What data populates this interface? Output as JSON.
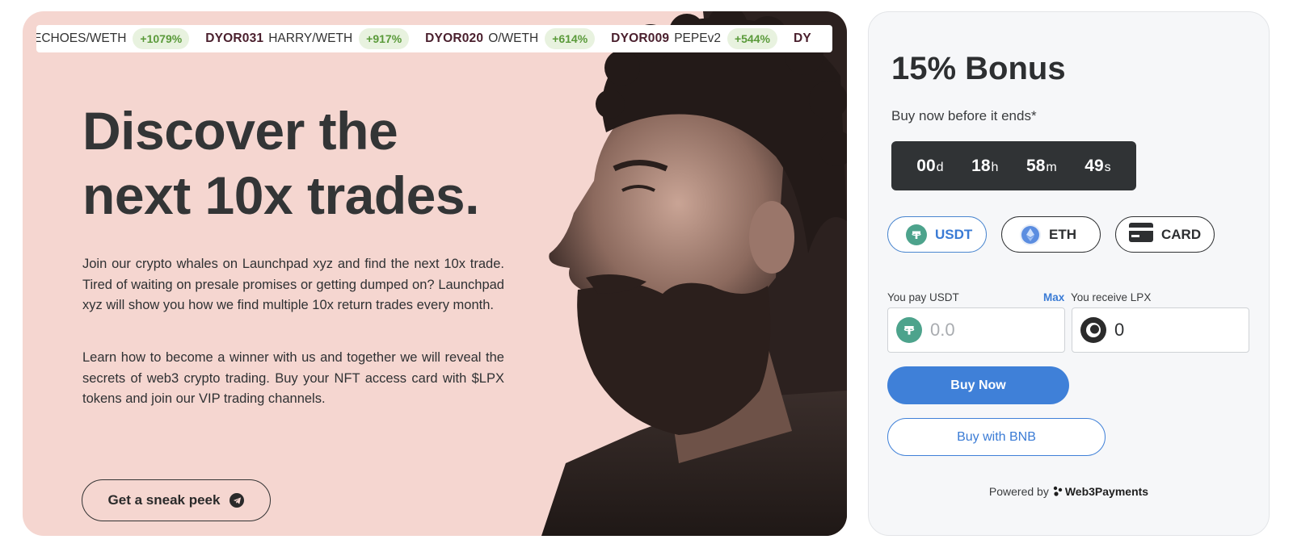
{
  "ticker": [
    {
      "code": "",
      "pair": "ECHOES/WETH",
      "pct": "+1079%"
    },
    {
      "code": "DYOR031",
      "pair": "HARRY/WETH",
      "pct": "+917%"
    },
    {
      "code": "DYOR020",
      "pair": "O/WETH",
      "pct": "+614%"
    },
    {
      "code": "DYOR009",
      "pair": "PEPEv2",
      "pct": "+544%"
    },
    {
      "code": "DY",
      "pair": "",
      "pct": ""
    }
  ],
  "hero": {
    "title_line1": "Discover the",
    "title_line2": "next 10x trades.",
    "paragraph1": "Join our crypto whales on Launchpad xyz and find the next 10x trade. Tired of waiting on presale promises or getting dumped on? Launchpad xyz will show you how we find multiple 10x return trades every month.",
    "paragraph2": "Learn how to become a winner with us and together we will reveal the secrets of web3 crypto trading. Buy your NFT access card with $LPX tokens and join our VIP trading channels.",
    "cta_label": "Get a sneak peek"
  },
  "widget": {
    "bonus_title": "15% Bonus",
    "bonus_sub": "Buy now before it ends*",
    "countdown": {
      "days": "00",
      "days_lbl": "d",
      "hours": "18",
      "hours_lbl": "h",
      "minutes": "58",
      "minutes_lbl": "m",
      "seconds": "49",
      "seconds_lbl": "s"
    },
    "tabs": {
      "usdt": "USDT",
      "eth": "ETH",
      "card": "CARD"
    },
    "pay_label": "You pay USDT",
    "max_label": "Max",
    "receive_label": "You receive LPX",
    "pay_placeholder": "0.0",
    "receive_value": "0",
    "buy_now": "Buy Now",
    "buy_bnb": "Buy with BNB",
    "powered_by": "Powered by",
    "powered_brand": "Web3Payments"
  },
  "colors": {
    "hero_bg": "#f5d6d0",
    "accent": "#3f80d8",
    "ticker_green": "#5a9a3a",
    "usdt": "#4da38c"
  }
}
